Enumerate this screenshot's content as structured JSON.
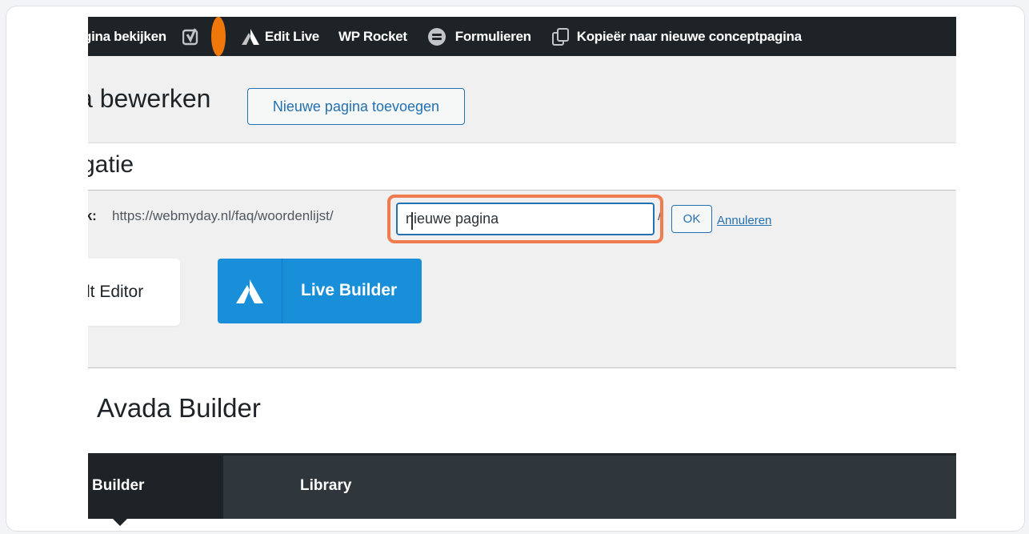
{
  "admin_bar": {
    "view_page": "gina bekijken",
    "edit_live": "Edit Live",
    "wp_rocket": "WP Rocket",
    "forms": "Formulieren",
    "copy_to_draft": "Kopieër naar nieuwe conceptpagina",
    "status_dot_color": "#f0780a"
  },
  "page_header": {
    "title": "a bewerken",
    "add_new_label": "Nieuwe pagina toevoegen"
  },
  "post_title": "gatie",
  "permalink": {
    "label": "ık:",
    "url_prefix": "https://webmyday.nl/faq/woordenlijst/",
    "slug_value": "nieuwe pagina",
    "trailing_slash": "/",
    "ok_label": "OK",
    "cancel_label": "Annuleren"
  },
  "editors": {
    "default_label": "lt Editor",
    "live_builder_label": "Live Builder"
  },
  "builder_section": {
    "title": "Avada Builder",
    "tabs": [
      "Builder",
      "Library"
    ]
  },
  "colors": {
    "accent": "#2271b1",
    "live_builder": "#198fd9",
    "focus_ring": "#f07b4f",
    "admin_bar": "#1d2327"
  }
}
